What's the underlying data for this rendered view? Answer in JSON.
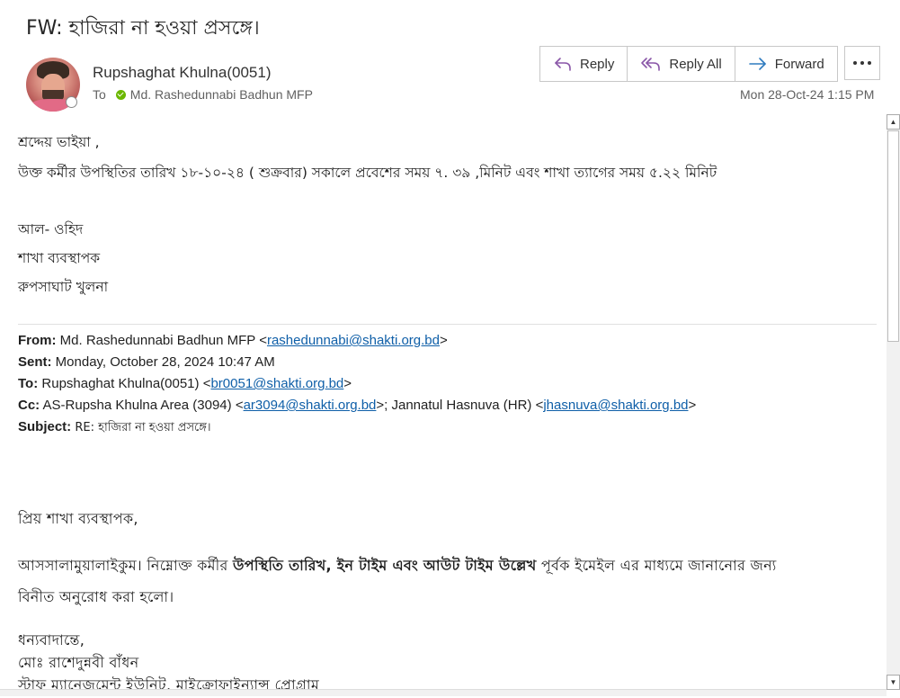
{
  "email": {
    "subject": "FW: হাজিরা না হওয়া প্রসঙ্গে।",
    "sender": "Rupshaghat Khulna(0051)",
    "to_label": "To",
    "recipient": "Md. Rashedunnabi Badhun MFP",
    "datetime": "Mon 28-Oct-24 1:15 PM"
  },
  "actions": {
    "reply": "Reply",
    "reply_all": "Reply All",
    "forward": "Forward"
  },
  "colors": {
    "accent": "#0f5fa8",
    "presence_green": "#6bb700",
    "icon_purple": "#8a57a8"
  },
  "body": {
    "greeting": "শ্রদ্দেয় ভাইয়া ,",
    "message": "উক্ত কর্মীর  উপস্থিতির তারিখ ১৮-১০-২৪ ( শুক্রবার) সকালে প্রবেশের সময় ৭. ৩৯ ,মিনিট এবং শাখা ত্যাগের সময় ৫.২২ মিনিট",
    "signature_name": "আল- ওহিদ",
    "signature_title": "শাখা ব্যবস্থাপক",
    "signature_branch": "রুপসাঘাট খুলনা"
  },
  "forwarded": {
    "from_label": "From:",
    "from_name": "Md. Rashedunnabi Badhun MFP <",
    "from_email": "rashedunnabi@shakti.org.bd",
    "sent_label": "Sent:",
    "sent_value": "Monday, October 28, 2024 10:47 AM",
    "to_label": "To:",
    "to_name": "Rupshaghat Khulna(0051) <",
    "to_email": "br0051@shakti.org.bd",
    "cc_label": "Cc:",
    "cc_name1": "AS-Rupsha Khulna Area (3094) <",
    "cc_email1": "ar3094@shakti.org.bd",
    "cc_sep": ">; Jannatul Hasnuva (HR) <",
    "cc_email2": "jhasnuva@shakti.org.bd",
    "close_bracket": ">",
    "subject_label": "Subject:",
    "subject_value": "RE: হাজিরা না হওয়া প্রসঙ্গে।",
    "salutation": "প্রিয়  শাখা  ব্যবস্থাপক,",
    "para_start": "আসসালামুয়ালাইকুম। নিম্নোক্ত  কর্মীর  ",
    "para_bold": "উপস্থিতি তারিখ, ইন টাইম এবং আউট টাইম উল্লেখ",
    "para_end": "  পূর্বক  ইমেইল  এর  মাধ্যমে  জানানোর  জন্য",
    "para_line2": "বিনীত  অনুরোধ  করা  হলো।",
    "closing": "ধন্যবাদান্তে,",
    "closing_name": "মোঃ  রাশেদুন্নবী  বাঁধন",
    "closing_dept": "স্টাফ  ম্যানেজমেন্ট  ইউনিট,  মাইক্রোফাইন্যান্স  প্রোগ্রাম"
  }
}
